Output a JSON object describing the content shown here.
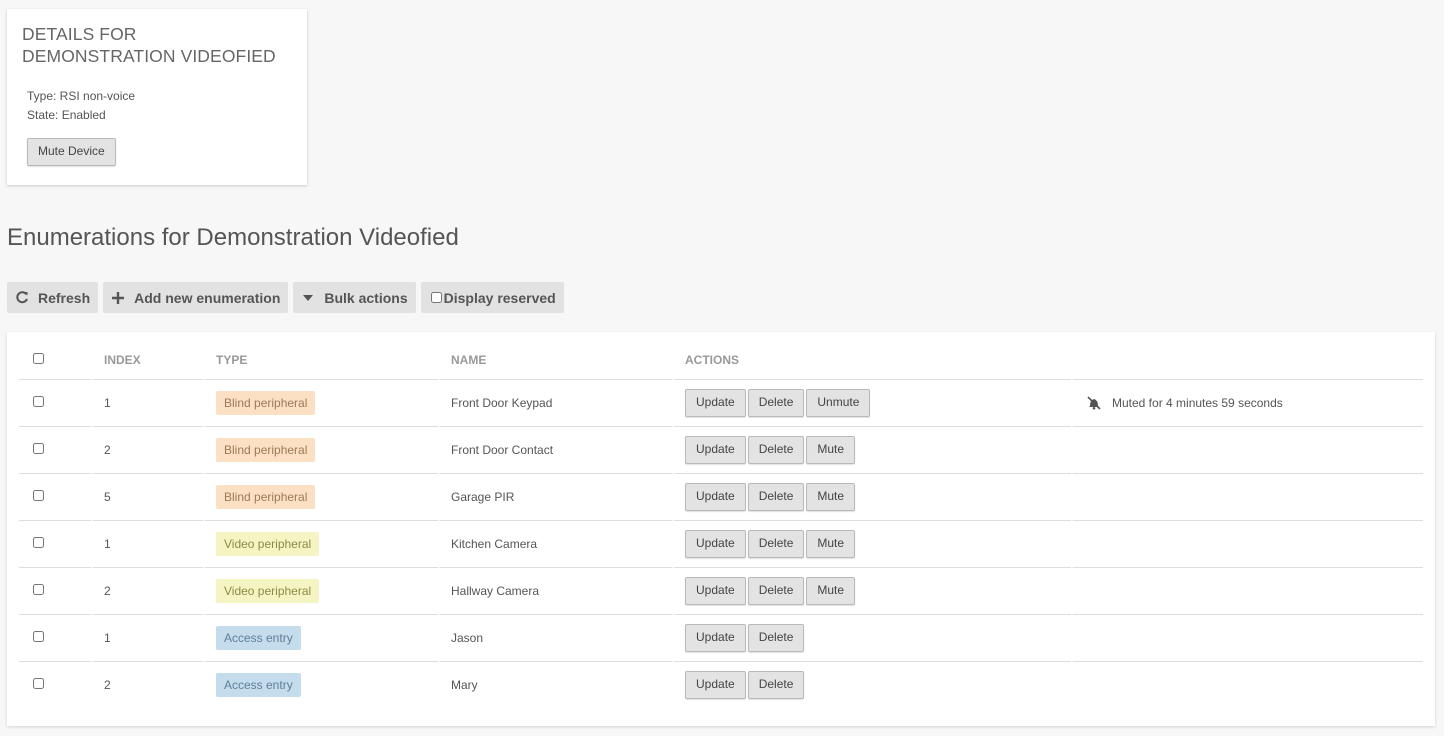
{
  "details": {
    "title": "DETAILS FOR DEMONSTRATION VIDEOFIED",
    "type_line": "Type: RSI non-voice",
    "state_line": "State: Enabled",
    "mute_button": "Mute Device"
  },
  "heading": "Enumerations for Demonstration Videofied",
  "toolbar": {
    "refresh": "Refresh",
    "add_new": "Add new enumeration",
    "bulk": "Bulk actions",
    "display_reserved": "Display reserved"
  },
  "table": {
    "headers": {
      "index": "INDEX",
      "type": "TYPE",
      "name": "NAME",
      "actions": "ACTIONS"
    },
    "rows": [
      {
        "index": "1",
        "type": "Blind peripheral",
        "name": "Front Door Keypad",
        "actions": [
          "Update",
          "Delete",
          "Unmute"
        ],
        "status": "Muted for 4 minutes 59 seconds"
      },
      {
        "index": "2",
        "type": "Blind peripheral",
        "name": "Front Door Contact",
        "actions": [
          "Update",
          "Delete",
          "Mute"
        ]
      },
      {
        "index": "5",
        "type": "Blind peripheral",
        "name": "Garage PIR",
        "actions": [
          "Update",
          "Delete",
          "Mute"
        ]
      },
      {
        "index": "1",
        "type": "Video peripheral",
        "name": "Kitchen Camera",
        "actions": [
          "Update",
          "Delete",
          "Mute"
        ]
      },
      {
        "index": "2",
        "type": "Video peripheral",
        "name": "Hallway Camera",
        "actions": [
          "Update",
          "Delete",
          "Mute"
        ]
      },
      {
        "index": "1",
        "type": "Access entry",
        "name": "Jason",
        "actions": [
          "Update",
          "Delete"
        ]
      },
      {
        "index": "2",
        "type": "Access entry",
        "name": "Mary",
        "actions": [
          "Update",
          "Delete"
        ]
      }
    ]
  },
  "badge_colors": {
    "Blind peripheral": "#fce0c4",
    "Video peripheral": "#f4f5c3",
    "Access entry": "#c5dcec"
  }
}
